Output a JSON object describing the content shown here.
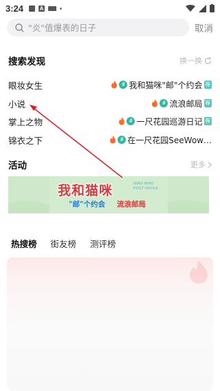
{
  "status_bar": {
    "time": "3:24",
    "icon_a": "A"
  },
  "search": {
    "placeholder": "\"炎\"值爆表的日子",
    "cancel_label": "取消"
  },
  "discover": {
    "title": "搜索发现",
    "refresh_label": "换一换",
    "items": [
      {
        "left": "眼妆女生",
        "topic": "我和猫咪\"邮\"个约会",
        "badge": "荐"
      },
      {
        "left": "小说",
        "topic": "流浪邮局",
        "badge": "荐"
      },
      {
        "left": "掌上之物",
        "topic": "一尺花园巡游日记",
        "badge": "荐"
      },
      {
        "left": "锦衣之下",
        "topic": "在一尺花园SeeWow…",
        "badge": ""
      }
    ]
  },
  "activity": {
    "title": "活动",
    "more_label": "更多",
    "banner_title": "我和猫咪",
    "banner_en_1": "MIAO MIAO",
    "banner_en_2": "POST OFFICE",
    "banner_sub": "\"邮\"个约会",
    "banner_sub2": "流浪邮局"
  },
  "tabs": [
    "热搜榜",
    "街友榜",
    "测评榜"
  ],
  "colors": {
    "accent_teal": "#2fb8a0",
    "fire": "#ff6a2b",
    "arrow": "#d8232a"
  }
}
